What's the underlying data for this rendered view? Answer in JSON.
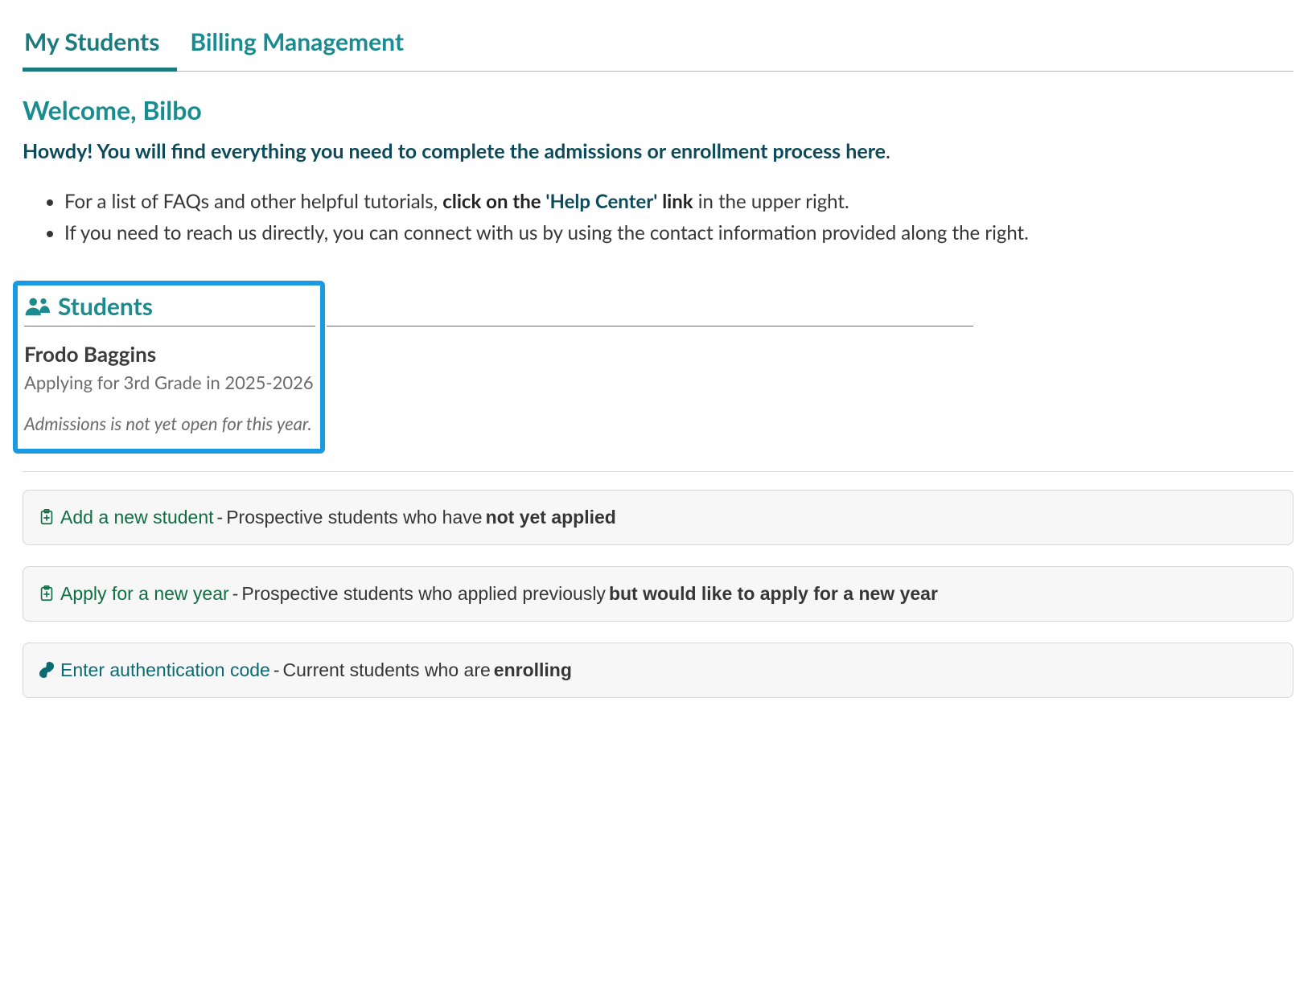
{
  "tabs": {
    "my_students": "My Students",
    "billing": "Billing Management"
  },
  "welcome": "Welcome, Bilbo",
  "intro_bold": "Howdy! You will find everything you need to complete the admissions or enrollment process here",
  "tips": {
    "faq_pre": "For a list of FAQs and other helpful tutorials, ",
    "faq_click": "click on the ",
    "faq_help": "'Help Center'",
    "faq_link": " link",
    "faq_post": " in the upper right.",
    "contact": "If you need to reach us directly, you can connect with us by using the contact information provided along the right."
  },
  "students_section": {
    "title": "Students",
    "student": {
      "name": "Frodo Baggins",
      "meta": "Applying for 3rd Grade in 2025-2026",
      "status": "Admissions is not yet open for this year."
    }
  },
  "actions": {
    "add": {
      "link": "Add a new student",
      "sep": " - ",
      "text": "Prospective students who have ",
      "bold": "not yet applied"
    },
    "apply": {
      "link": "Apply for a new year",
      "sep": " - ",
      "text": "Prospective students who applied previously ",
      "bold": "but would like to apply for a new year"
    },
    "auth": {
      "link": "Enter authentication code",
      "sep": " - ",
      "text": "Current students who are ",
      "bold": "enrolling"
    }
  }
}
